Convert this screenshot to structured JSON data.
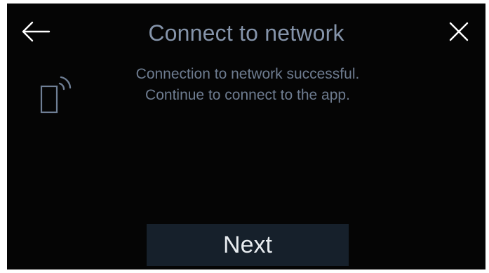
{
  "header": {
    "title": "Connect to network",
    "back_icon": "arrow-left-icon",
    "close_icon": "close-icon"
  },
  "content": {
    "icon": "phone-wireless-icon",
    "message_line1": "Connection to network successful.",
    "message_line2": "Continue to connect to the app."
  },
  "footer": {
    "next_label": "Next"
  },
  "colors": {
    "background": "#050505",
    "text": "#7f8ea3",
    "button_bg": "#16202b",
    "button_text": "#e8ecf0"
  }
}
